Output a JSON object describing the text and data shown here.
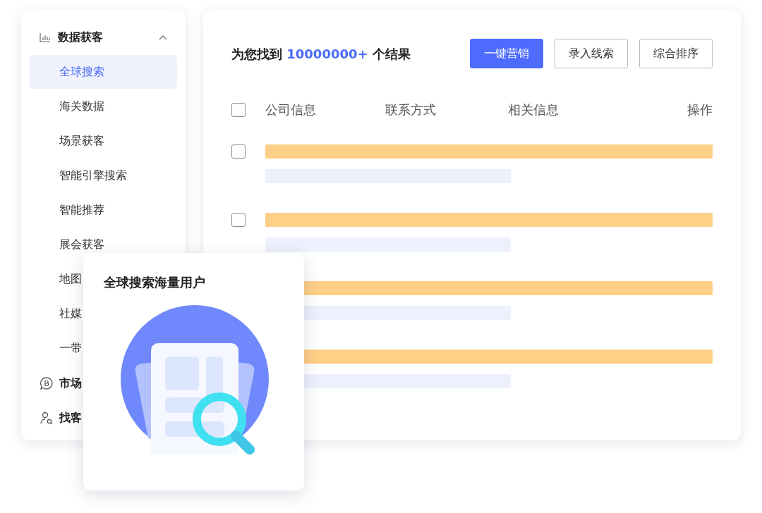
{
  "sidebar": {
    "groups": [
      {
        "label": "数据获客",
        "expanded": true,
        "items": [
          {
            "label": "全球搜索",
            "selected": true
          },
          {
            "label": "海关数据",
            "selected": false
          },
          {
            "label": "场景获客",
            "selected": false
          },
          {
            "label": "智能引擎搜索",
            "selected": false
          },
          {
            "label": "智能推荐",
            "selected": false
          },
          {
            "label": "展会获客",
            "selected": false
          },
          {
            "label": "地图",
            "selected": false
          },
          {
            "label": "社媒",
            "selected": false
          },
          {
            "label": "一带",
            "selected": false
          }
        ]
      },
      {
        "label": "市场"
      },
      {
        "label": "找客"
      }
    ]
  },
  "results": {
    "prefix": "为您找到",
    "count": "10000000+",
    "suffix": "个结果"
  },
  "buttons": [
    {
      "label": "一键营销",
      "kind": "primary"
    },
    {
      "label": "录入线索",
      "kind": "outline"
    },
    {
      "label": "综合排序",
      "kind": "outline"
    }
  ],
  "table": {
    "select_all": {
      "checked": false
    },
    "columns": [
      "公司信息",
      "联系方式",
      "相关信息",
      "操作"
    ],
    "rows": [
      {
        "checked": false
      },
      {
        "checked": false
      },
      {},
      {}
    ]
  },
  "popup": {
    "title": "全球搜索海量用户"
  }
}
